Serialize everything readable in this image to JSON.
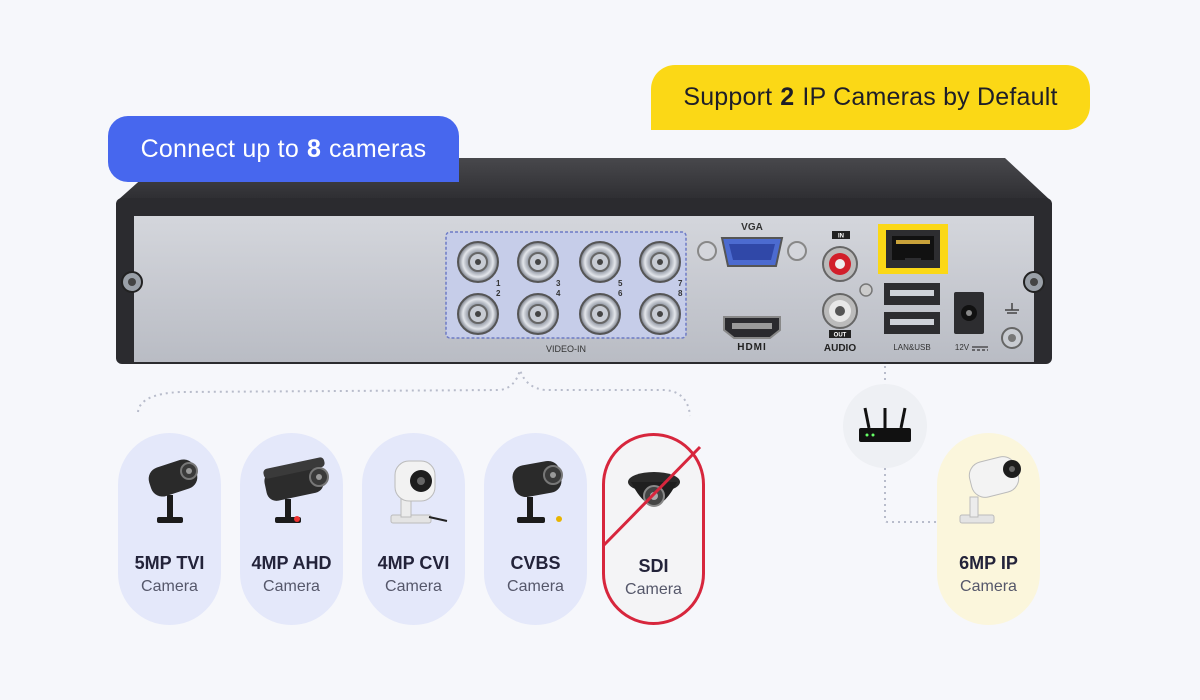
{
  "badges": {
    "cameras": {
      "prefix": "Connect up to",
      "number": "8",
      "suffix": "cameras"
    },
    "ip": {
      "prefix": "Support",
      "number": "2",
      "suffix": "IP Cameras by Default"
    }
  },
  "dvr": {
    "vga_label": "VGA",
    "video_in_label": "VIDEO-IN",
    "hdmi_label": "HDMI",
    "audio_label": "AUDIO",
    "audio_in_label": "IN",
    "audio_out_label": "OUT",
    "lan_usb_label": "LAN&USB",
    "power_label": "12V",
    "channel_labels": [
      "1",
      "2",
      "3",
      "4",
      "5",
      "6",
      "7",
      "8"
    ]
  },
  "cameras": [
    {
      "name": "5MP TVI",
      "sub": "Camera",
      "icon": "bullet-camera-icon",
      "supported": true
    },
    {
      "name": "4MP AHD",
      "sub": "Camera",
      "icon": "bullet-camera-icon",
      "supported": true
    },
    {
      "name": "4MP CVI",
      "sub": "Camera",
      "icon": "white-bullet-camera-icon",
      "supported": true
    },
    {
      "name": "CVBS",
      "sub": "Camera",
      "icon": "bullet-camera-icon",
      "supported": true
    },
    {
      "name": "SDI",
      "sub": "Camera",
      "icon": "dome-camera-icon",
      "supported": false
    }
  ],
  "ip_camera": {
    "name": "6MP IP",
    "sub": "Camera",
    "icon": "white-bullet-camera-icon"
  },
  "colors": {
    "blue_badge": "#4767ee",
    "yellow_badge": "#fbd816",
    "unsupported": "#d7263d"
  }
}
